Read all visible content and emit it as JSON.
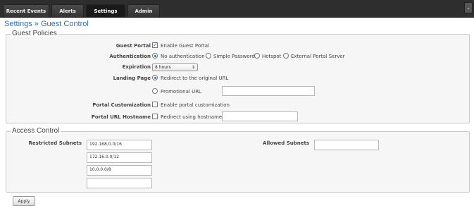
{
  "nav": {
    "tabs": [
      {
        "label": "Recent Events"
      },
      {
        "label": "Alerts"
      },
      {
        "label": "Settings"
      },
      {
        "label": "Admin"
      }
    ],
    "active_tab": "Settings",
    "corner_icon": "chevron-down-icon"
  },
  "breadcrumb": "Settings » Guest Control",
  "guest_policies": {
    "title": "Guest Policies",
    "guest_portal": {
      "label": "Guest Portal",
      "checkbox_label": "Enable Guest Portal",
      "checked": true
    },
    "authentication": {
      "label": "Authentication",
      "options": [
        "No authentication",
        "Simple Password",
        "Hotspot",
        "External Portal Server"
      ],
      "selected": "No authentication"
    },
    "expiration": {
      "label": "Expiration",
      "value": "8 hours"
    },
    "landing_page": {
      "label": "Landing Page",
      "option_redirect": "Redirect to the original URL",
      "option_promo": "Promotional URL",
      "selected": "Redirect to the original URL",
      "promo_url_value": ""
    },
    "portal_customization": {
      "label": "Portal Customization",
      "checkbox_label": "Enable portal customization",
      "checked": false
    },
    "portal_hostname": {
      "label": "Portal URL Hostname",
      "checkbox_label": "Redirect using hostname",
      "checked": false,
      "value": ""
    }
  },
  "access_control": {
    "title": "Access Control",
    "restricted_label": "Restricted Subnets",
    "restricted_subnets": [
      "192.168.0.0/16",
      "172.16.0.0/12",
      "10.0.0.0/8",
      ""
    ],
    "allowed_label": "Allowed Subnets",
    "allowed_subnets": [
      ""
    ]
  },
  "apply_label": "Apply"
}
